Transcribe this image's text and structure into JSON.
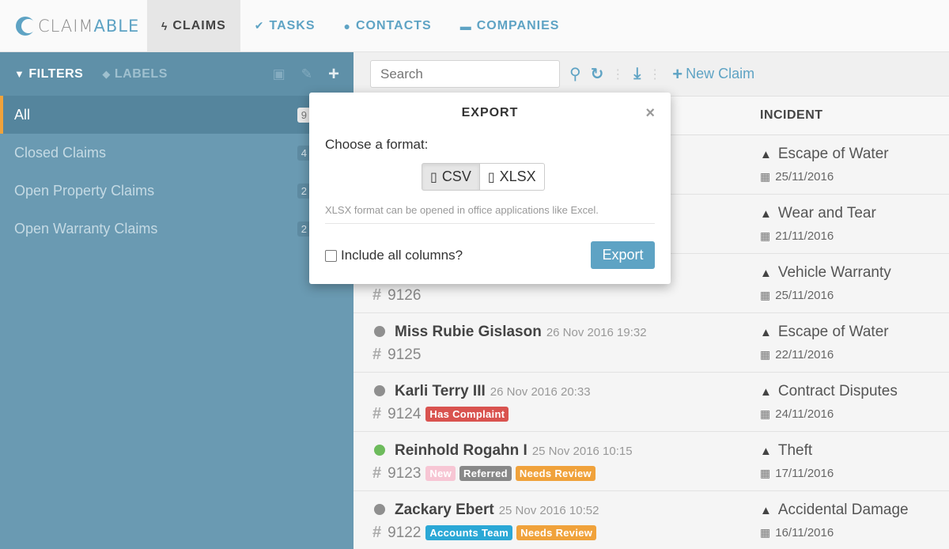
{
  "app": {
    "logo_prefix": "CLAIM",
    "logo_suffix": "ABLE"
  },
  "nav": {
    "tabs": [
      {
        "label": "CLAIMS",
        "icon": "lightning-icon"
      },
      {
        "label": "TASKS",
        "icon": "check-icon"
      },
      {
        "label": "CONTACTS",
        "icon": "user-icon"
      },
      {
        "label": "COMPANIES",
        "icon": "briefcase-icon"
      }
    ]
  },
  "sidebar": {
    "filters_label": "FILTERS",
    "labels_label": "LABELS",
    "items": [
      {
        "label": "All",
        "count": "9"
      },
      {
        "label": "Closed Claims",
        "count": "4"
      },
      {
        "label": "Open Property Claims",
        "count": "2"
      },
      {
        "label": "Open Warranty Claims",
        "count": "2"
      }
    ]
  },
  "toolbar": {
    "search_placeholder": "Search",
    "new_claim_label": "New Claim"
  },
  "table": {
    "incident_header": "INCIDENT",
    "rows": [
      {
        "name": "",
        "date": "",
        "number": "",
        "tags": [],
        "incident": "Escape of Water",
        "incident_date": "25/11/2016"
      },
      {
        "name": "",
        "date": "",
        "number": "",
        "tags": [],
        "incident": "Wear and Tear",
        "incident_date": "21/11/2016"
      },
      {
        "name": "",
        "date": "",
        "number": "9126",
        "tags": [],
        "incident": "Vehicle Warranty",
        "incident_date": "25/11/2016"
      },
      {
        "name": "Miss Rubie Gislason",
        "date": "26 Nov 2016 19:32",
        "number": "9125",
        "status": "grey",
        "tags": [],
        "incident": "Escape of Water",
        "incident_date": "22/11/2016"
      },
      {
        "name": "Karli Terry III",
        "date": "26 Nov 2016 20:33",
        "number": "9124",
        "status": "grey",
        "tags": [
          {
            "label": "Has Complaint",
            "color": "#d9534f"
          }
        ],
        "incident": "Contract Disputes",
        "incident_date": "24/11/2016"
      },
      {
        "name": "Reinhold Rogahn I",
        "date": "25 Nov 2016 10:15",
        "number": "9123",
        "status": "green",
        "tags": [
          {
            "label": "New",
            "color": "#f7c6d4"
          },
          {
            "label": "Referred",
            "color": "#888888"
          },
          {
            "label": "Needs Review",
            "color": "#f0a23b"
          }
        ],
        "incident": "Theft",
        "incident_date": "17/11/2016"
      },
      {
        "name": "Zackary Ebert",
        "date": "25 Nov 2016 10:52",
        "number": "9122",
        "status": "grey",
        "tags": [
          {
            "label": "Accounts Team",
            "color": "#2ba8d6"
          },
          {
            "label": "Needs Review",
            "color": "#f0a23b"
          }
        ],
        "incident": "Accidental Damage",
        "incident_date": "16/11/2016"
      }
    ]
  },
  "modal": {
    "title": "EXPORT",
    "choose_label": "Choose a format:",
    "formats": [
      {
        "label": "CSV",
        "selected": true
      },
      {
        "label": "XLSX",
        "selected": false
      }
    ],
    "hint": "XLSX format can be opened in office applications like Excel.",
    "include_all_label": "Include all columns?",
    "include_all_checked": false,
    "export_label": "Export"
  },
  "colors": {
    "accent": "#5ea3c4",
    "sidebar": "#6a9ab2",
    "active_marker": "#f0a23b"
  }
}
